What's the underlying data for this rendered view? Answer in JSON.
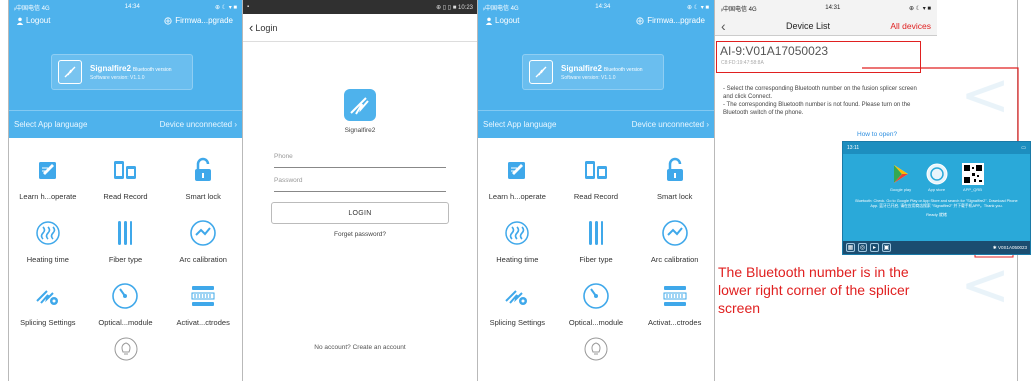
{
  "screen1": {
    "status": {
      "left": "ᵢₗ中国电信 4G",
      "center": "14:34",
      "right": "⊕ ☾ ▾ ■"
    },
    "logout": "Logout",
    "firmware": "Firmwa...pgrade",
    "app_name": "Signalfire2",
    "app_sub": "Bluetooth version",
    "software_version": "Software version: V1.1.0",
    "language": "Select App language",
    "device_status": "Device unconnected",
    "items": [
      {
        "label": "Learn h...operate",
        "icon": "book-edit-icon"
      },
      {
        "label": "Read Record",
        "icon": "record-icon"
      },
      {
        "label": "Smart lock",
        "icon": "lock-icon"
      },
      {
        "label": "Heating time",
        "icon": "heating-icon"
      },
      {
        "label": "Fiber type",
        "icon": "fiber-icon"
      },
      {
        "label": "Arc calibration",
        "icon": "arc-icon"
      },
      {
        "label": "Splicing Settings",
        "icon": "splice-settings-icon"
      },
      {
        "label": "Optical...module",
        "icon": "gauge-icon"
      },
      {
        "label": "Activat...ctrodes",
        "icon": "electrodes-icon"
      }
    ]
  },
  "screen2": {
    "status_right": "⊕ ▯ ▯ ■ 10:23",
    "back_label": "Login",
    "app_name": "Signalfire2",
    "phone_placeholder": "Phone",
    "password_placeholder": "Password",
    "login_button": "LOGIN",
    "forgot": "Forget password?",
    "no_account": "No account? Create an account"
  },
  "screen3": {
    "status": {
      "left": "ᵢₗ中国电信 4G",
      "center": "14:34",
      "right": "⊕ ☾ ▾ ■"
    },
    "logout": "Logout",
    "firmware": "Firmwa...pgrade",
    "app_name": "Signalfire2",
    "app_sub": "Bluetooth version",
    "software_version": "Software version: V1.1.0",
    "language": "Select App language",
    "device_status": "Device unconnected",
    "items": [
      {
        "label": "Learn h...operate"
      },
      {
        "label": "Read Record"
      },
      {
        "label": "Smart lock"
      },
      {
        "label": "Heating time"
      },
      {
        "label": "Fiber type"
      },
      {
        "label": "Arc calibration"
      },
      {
        "label": "Splicing Settings"
      },
      {
        "label": "Optical...module"
      },
      {
        "label": "Activat...ctrodes"
      }
    ]
  },
  "screen4": {
    "status": {
      "left": "ᵢₗ中国电信 4G",
      "center": "14:31",
      "right": "⊕ ☾ ▾ ■"
    },
    "title": "Device List",
    "all_devices": "All devices",
    "device_name": "AI-9:V01A17050023",
    "device_addr": "C8:FD:19:47:58:8A",
    "instructions": "- Select the corresponding Bluetooth number on the fusion splicer screen and click Connect.\n- The corresponding Bluetooth number is not found. Please turn on the Bluetooth switch of the phone.",
    "how_to_open": "How to open?"
  },
  "splicer": {
    "time": "13:11",
    "labels": [
      "Google play",
      "App store",
      "APP_QRB"
    ],
    "text": "Bluetooth: Check. Go to Google Play or App Store and search for \"Signalfire2\". Download Phone App. 蓝牙已开启, 请在应用商店搜索 \"Signalfire2\" 并下载手机APP。Thank you.",
    "ready": "Ready 就绪",
    "bt_number": "V0S1A050023"
  },
  "caption": "The Bluetooth number is in the lower right corner of the splicer screen",
  "colors": {
    "blue": "#4eb2ec",
    "red": "#e02020"
  }
}
